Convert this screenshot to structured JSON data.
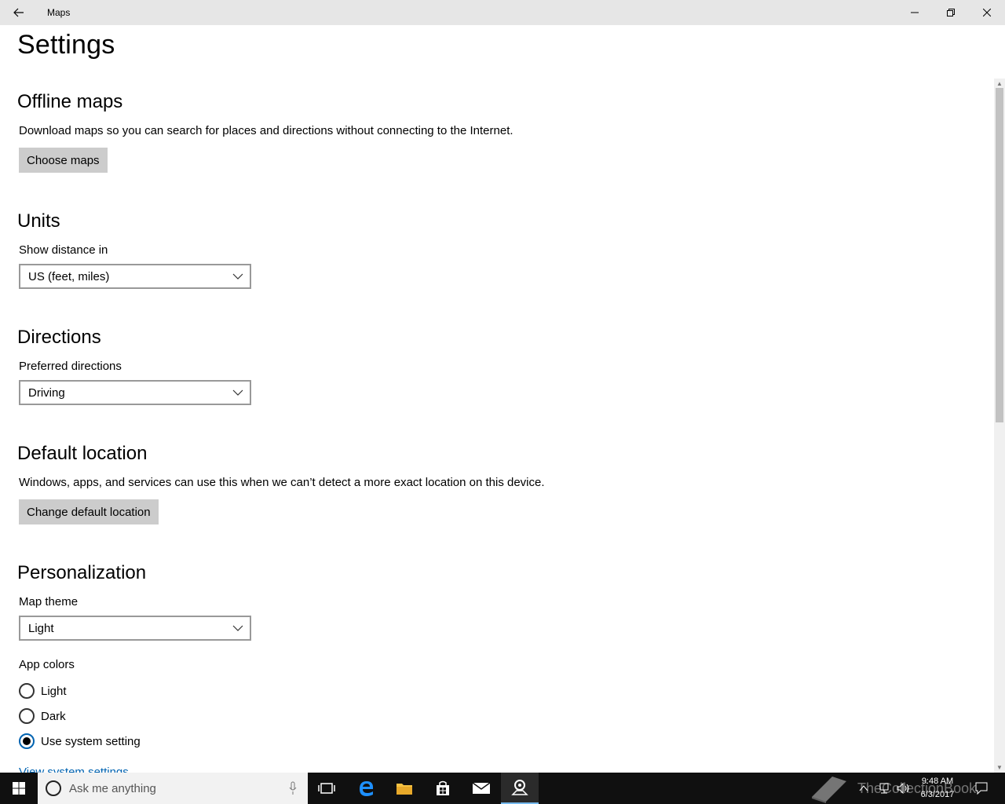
{
  "window": {
    "title": "Maps"
  },
  "page": {
    "title": "Settings"
  },
  "offline_maps": {
    "title": "Offline maps",
    "description": "Download maps so you can search for places and directions without connecting to the Internet.",
    "button": "Choose maps"
  },
  "units": {
    "title": "Units",
    "label": "Show distance in",
    "selected": "US (feet, miles)"
  },
  "directions": {
    "title": "Directions",
    "label": "Preferred directions",
    "selected": "Driving"
  },
  "default_location": {
    "title": "Default location",
    "description": "Windows, apps, and services can use this when we can’t detect a more exact location on this device.",
    "button": "Change default location"
  },
  "personalization": {
    "title": "Personalization",
    "map_theme_label": "Map theme",
    "map_theme_selected": "Light",
    "app_colors_label": "App colors",
    "app_colors_options": [
      {
        "label": "Light",
        "checked": false
      },
      {
        "label": "Dark",
        "checked": false
      },
      {
        "label": "Use system setting",
        "checked": true
      }
    ],
    "link": "View system settings"
  },
  "taskbar": {
    "search_placeholder": "Ask me anything",
    "time": "9:48 AM",
    "date": "6/3/2017",
    "watermark": "TheCollectionBook"
  },
  "colors": {
    "accent": "#0063b1",
    "titlebar": "#e6e6e6",
    "button": "#cccccc",
    "taskbar": "#101010"
  }
}
